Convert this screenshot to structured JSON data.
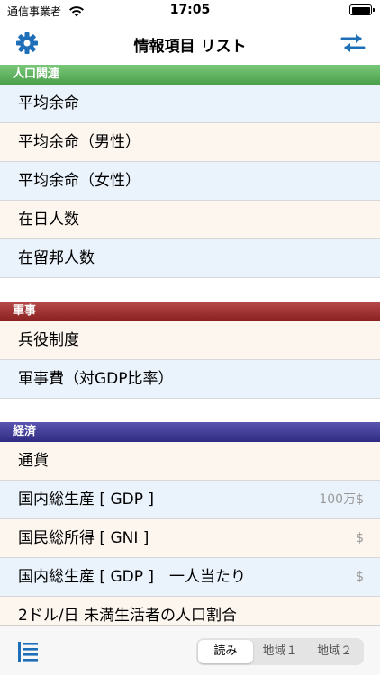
{
  "status": {
    "carrier": "通信事業者",
    "time": "17:05"
  },
  "navbar": {
    "title": "情報項目 リスト",
    "left_icon": "gear-icon",
    "right_icon": "swap-icon"
  },
  "sections": [
    {
      "title": "人口関連",
      "color": "#4b9f4b",
      "rows": [
        {
          "label": "平均余命",
          "unit": ""
        },
        {
          "label": "平均余命（男性）",
          "unit": ""
        },
        {
          "label": "平均余命（女性）",
          "unit": ""
        },
        {
          "label": "在日人数",
          "unit": ""
        },
        {
          "label": "在留邦人数",
          "unit": ""
        }
      ]
    },
    {
      "title": "軍事",
      "color": "#8a2020",
      "rows": [
        {
          "label": "兵役制度",
          "unit": ""
        },
        {
          "label": "軍事費（対GDP比率）",
          "unit": ""
        }
      ]
    },
    {
      "title": "経済",
      "color": "#2f2b82",
      "rows": [
        {
          "label": "通貨",
          "unit": ""
        },
        {
          "label": "国内総生産 [ GDP ]",
          "unit": "100万$"
        },
        {
          "label": "国民総所得 [ GNI ]",
          "unit": "$"
        },
        {
          "label": "国内総生産 [ GDP ]　一人当たり",
          "unit": "$"
        },
        {
          "label": "2ドル/日 未満生活者の人口割合",
          "unit": ""
        }
      ]
    }
  ],
  "toolbar": {
    "list_icon": "list-icon",
    "segments": [
      "読み",
      "地域１",
      "地域２"
    ],
    "selected": "読み"
  }
}
